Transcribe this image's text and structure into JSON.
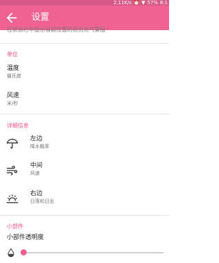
{
  "status": {
    "speed": "2.11K/s",
    "battery": "57%",
    "time": "8:1"
  },
  "app_bar": {
    "title": "设置"
  },
  "top_description": "在状态栏中显示当前位置的恶劣天气警报",
  "units": {
    "header": "单位",
    "temperature": {
      "title": "温度",
      "value": "摄氏度"
    },
    "wind": {
      "title": "风速",
      "value": "米/秒"
    }
  },
  "details": {
    "header": "详细信息",
    "items": [
      {
        "title": "左边",
        "subtitle": "降水概率"
      },
      {
        "title": "中间",
        "subtitle": "风速"
      },
      {
        "title": "右边",
        "subtitle": "日落和日出"
      }
    ]
  },
  "widget": {
    "header": "小部件",
    "opacity_title": "小部件透明度",
    "opacity_value": 0
  },
  "colors": {
    "accent": "#f06292",
    "status_bar": "#d65a86",
    "section": "#ef4f80"
  }
}
